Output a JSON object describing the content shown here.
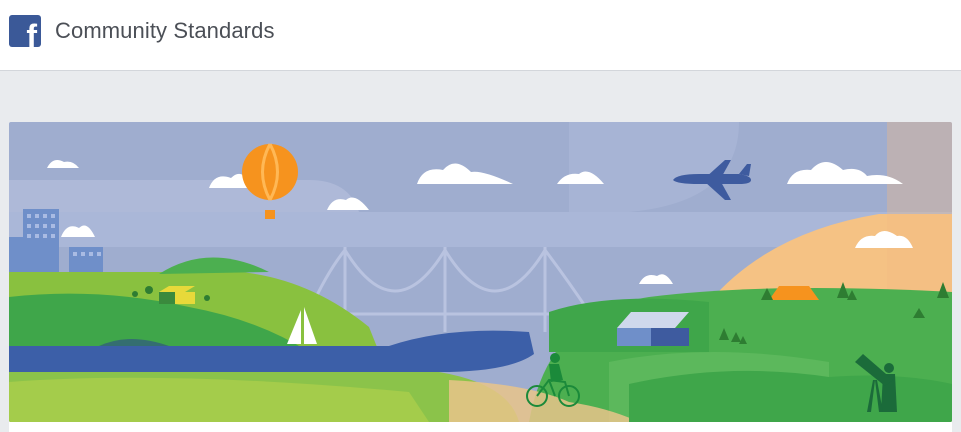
{
  "header": {
    "logo_letter": "f",
    "title": "Community Standards"
  },
  "banner": {
    "description": "",
    "colors": {
      "sky": "#9fadcf",
      "grass": "#3fa64a",
      "river": "#3c5fa8",
      "sunset": "#f5c284",
      "balloon": "#f6931e",
      "plane": "#3e5b9f"
    }
  },
  "colors": {
    "brand": "#3b5998",
    "title_text": "#4b4f56",
    "page_bg": "#e9ebee"
  }
}
